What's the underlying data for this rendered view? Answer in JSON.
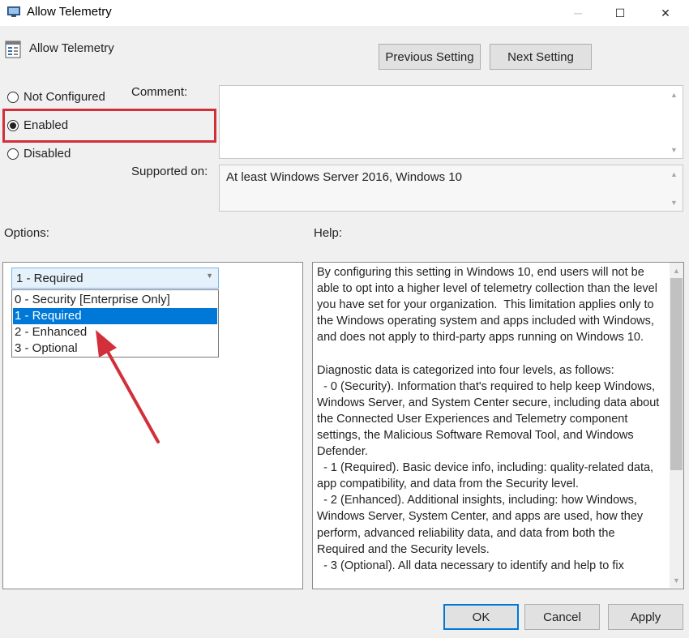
{
  "window": {
    "title": "Allow Telemetry",
    "minimize": "─",
    "maximize": "☐",
    "close": "✕"
  },
  "header": {
    "title": "Allow Telemetry",
    "prev_label": "Previous Setting",
    "next_label": "Next Setting"
  },
  "state": {
    "options": [
      {
        "label": "Not Configured",
        "selected": false
      },
      {
        "label": "Enabled",
        "selected": true
      },
      {
        "label": "Disabled",
        "selected": false
      }
    ]
  },
  "comment": {
    "label": "Comment:",
    "value": ""
  },
  "supported": {
    "label": "Supported on:",
    "value": "At least Windows Server 2016, Windows 10"
  },
  "options_panel": {
    "label": "Options:",
    "combo_value": "1 - Required",
    "items": [
      "0 - Security [Enterprise Only]",
      "1 - Required",
      "2 - Enhanced",
      "3 - Optional"
    ],
    "selected_index": 1
  },
  "help": {
    "label": "Help:",
    "text": "By configuring this setting in Windows 10, end users will not be able to opt into a higher level of telemetry collection than the level you have set for your organization.  This limitation applies only to the Windows operating system and apps included with Windows, and does not apply to third-party apps running on Windows 10.\n\nDiagnostic data is categorized into four levels, as follows:\n  - 0 (Security). Information that's required to help keep Windows, Windows Server, and System Center secure, including data about the Connected User Experiences and Telemetry component settings, the Malicious Software Removal Tool, and Windows Defender.\n  - 1 (Required). Basic device info, including: quality-related data, app compatibility, and data from the Security level.\n  - 2 (Enhanced). Additional insights, including: how Windows, Windows Server, System Center, and apps are used, how they perform, advanced reliability data, and data from both the Required and the Security levels.\n  - 3 (Optional). All data necessary to identify and help to fix"
  },
  "footer": {
    "ok_label": "OK",
    "cancel_label": "Cancel",
    "apply_label": "Apply"
  },
  "colors": {
    "highlight": "#d32f3a",
    "arrow": "#d32f3a",
    "selection": "#0078d7"
  }
}
